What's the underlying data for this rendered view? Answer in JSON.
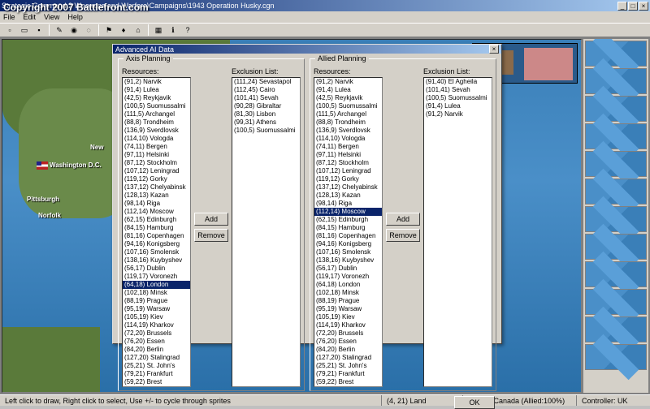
{
  "copyright": "Copyright 2007 Battlefront.com",
  "main_title": "Strategic Command 2 Weapons and Warfare\\Campaigns\\1943 Operation Husky.cgn",
  "menu": [
    "File",
    "Edit",
    "View",
    "Help"
  ],
  "dialog": {
    "title": "Advanced AI Data",
    "close": "×",
    "axis_label": "Axis Planning",
    "allied_label": "Allied Planning",
    "resources_label": "Resources:",
    "exclusion_label": "Exclusion List:",
    "add": "Add",
    "remove": "Remove",
    "ok": "OK"
  },
  "axis_resources": [
    "(91,2) Narvik",
    "(91,4) Lulea",
    "(42,5) Reykjavik",
    "(100,5) Suomussalmi",
    "(111,5) Archangel",
    "(88,8) Trondheim",
    "(136,9) Sverdlovsk",
    "(114,10) Vologda",
    "(74,11) Bergen",
    "(97,11) Helsinki",
    "(87,12) Stockholm",
    "(107,12) Leningrad",
    "(119,12) Gorky",
    "(137,12) Chelyabinsk",
    "(128,13) Kazan",
    "(98,14) Riga",
    "(112,14) Moscow",
    "(62,15) Edinburgh",
    "(84,15) Hamburg",
    "(81,16) Copenhagen",
    "(94,16) Konigsberg",
    "(107,16) Smolensk",
    "(138,16) Kuybyshev",
    "(56,17) Dublin",
    "(119,17) Voronezh",
    "(64,18) London",
    "(102,18) Minsk",
    "(88,19) Prague",
    "(95,19) Warsaw",
    "(105,19) Kiev",
    "(114,19) Kharkov",
    "(72,20) Brussels",
    "(76,20) Essen",
    "(84,20) Berlin",
    "(127,20) Stalingrad",
    "(25,21) St. John's",
    "(79,21) Frankfurt",
    "(59,22) Brest"
  ],
  "axis_resources_selected": 25,
  "axis_exclusion": [
    "(111,24) Sevastapol",
    "(112,45) Cairo",
    "(101,41) Sevah",
    "(90,28) Gibraltar",
    "(81,30) Lisbon",
    "(99,31) Athens",
    "(100,5) Suomussalmi"
  ],
  "allied_resources": [
    "(91,2) Narvik",
    "(91,4) Lulea",
    "(42,5) Reykjavik",
    "(100,5) Suomussalmi",
    "(111,5) Archangel",
    "(88,8) Trondheim",
    "(136,9) Sverdlovsk",
    "(114,10) Vologda",
    "(74,11) Bergen",
    "(97,11) Helsinki",
    "(87,12) Stockholm",
    "(107,12) Leningrad",
    "(119,12) Gorky",
    "(137,12) Chelyabinsk",
    "(128,13) Kazan",
    "(98,14) Riga",
    "(112,14) Moscow",
    "(62,15) Edinburgh",
    "(84,15) Hamburg",
    "(81,16) Copenhagen",
    "(94,16) Konigsberg",
    "(107,16) Smolensk",
    "(138,16) Kuybyshev",
    "(56,17) Dublin",
    "(119,17) Voronezh",
    "(64,18) London",
    "(102,18) Minsk",
    "(88,19) Prague",
    "(95,19) Warsaw",
    "(105,19) Kiev",
    "(114,19) Kharkov",
    "(72,20) Brussels",
    "(76,20) Essen",
    "(84,20) Berlin",
    "(127,20) Stalingrad",
    "(25,21) St. John's",
    "(79,21) Frankfurt",
    "(59,22) Brest"
  ],
  "allied_resources_selected": 16,
  "allied_exclusion": [
    "(91,40) El Agheila",
    "(101,41) Sevah",
    "(100,5) Suomussalmi",
    "(91,4) Lulea",
    "(91,2) Narvik"
  ],
  "cities": {
    "washington": "Washington D.C.",
    "newyork": "New",
    "pittsburgh": "Pittsburgh",
    "norfolk": "Norfolk"
  },
  "status": {
    "hint": "Left click to draw, Right click to select, Use +/- to cycle through sprites",
    "coord": "(4, 21) Land",
    "owner": "Owner:  Canada (Allied:100%)",
    "controller": "Controller:  UK"
  },
  "win_buttons": {
    "min": "_",
    "max": "□",
    "close": "×"
  }
}
